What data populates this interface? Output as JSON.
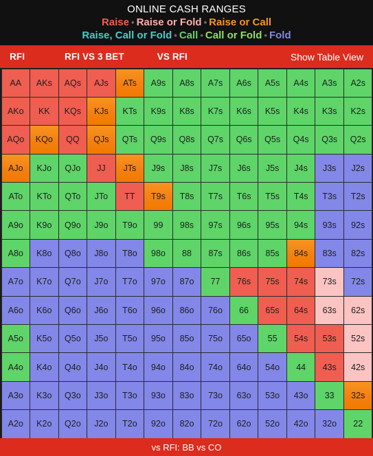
{
  "header": {
    "title": "ONLINE CASH RANGES",
    "legend_line1": [
      {
        "label": "Raise",
        "color": "#ef5e50"
      },
      {
        "label": "Raise or Fold",
        "color": "#fcb0ab"
      },
      {
        "label": "Raise or Call",
        "color": "#f79420"
      }
    ],
    "legend_line2": [
      {
        "label": "Raise, Call or Fold",
        "color": "#3fd0c9"
      },
      {
        "label": "Call",
        "color": "#5fd469"
      },
      {
        "label": "Call or Fold",
        "color": "#8ee05f"
      },
      {
        "label": "Fold",
        "color": "#8287e8"
      }
    ],
    "separator": "•"
  },
  "nav": {
    "items": [
      {
        "label": "RFI",
        "key": "rfi"
      },
      {
        "label": "RFI VS 3 BET",
        "key": "rfi-vs-3bet"
      },
      {
        "label": "VS RFI",
        "key": "vs-rfi"
      }
    ],
    "show_table_view": "Show Table View"
  },
  "footer": {
    "caption": "vs RFI: BB vs CO"
  },
  "chart_data": {
    "type": "heatmap",
    "title": "ONLINE CASH RANGES",
    "subtitle": "vs RFI: BB vs CO",
    "xlabel": "",
    "ylabel": "",
    "ranks": [
      "A",
      "K",
      "Q",
      "J",
      "T",
      "9",
      "8",
      "7",
      "6",
      "5",
      "4",
      "3",
      "2"
    ],
    "categories_legend": {
      "raise": "Raise",
      "raisefold": "Raise or Fold",
      "raisecall": "Raise or Call",
      "raisecallfold": "Raise, Call or Fold",
      "call": "Call",
      "callfold": "Call or Fold",
      "fold": "Fold"
    },
    "rows": [
      {
        "cells": [
          {
            "hand": "AA",
            "action": "raise"
          },
          {
            "hand": "AKs",
            "action": "raise"
          },
          {
            "hand": "AQs",
            "action": "raise"
          },
          {
            "hand": "AJs",
            "action": "raise"
          },
          {
            "hand": "ATs",
            "action": "raisecall"
          },
          {
            "hand": "A9s",
            "action": "call"
          },
          {
            "hand": "A8s",
            "action": "call"
          },
          {
            "hand": "A7s",
            "action": "call"
          },
          {
            "hand": "A6s",
            "action": "call"
          },
          {
            "hand": "A5s",
            "action": "call"
          },
          {
            "hand": "A4s",
            "action": "call"
          },
          {
            "hand": "A3s",
            "action": "call"
          },
          {
            "hand": "A2s",
            "action": "call"
          }
        ]
      },
      {
        "cells": [
          {
            "hand": "AKo",
            "action": "raise"
          },
          {
            "hand": "KK",
            "action": "raise"
          },
          {
            "hand": "KQs",
            "action": "raise"
          },
          {
            "hand": "KJs",
            "action": "raisecall"
          },
          {
            "hand": "KTs",
            "action": "call"
          },
          {
            "hand": "K9s",
            "action": "call"
          },
          {
            "hand": "K8s",
            "action": "call"
          },
          {
            "hand": "K7s",
            "action": "call"
          },
          {
            "hand": "K6s",
            "action": "call"
          },
          {
            "hand": "K5s",
            "action": "call"
          },
          {
            "hand": "K4s",
            "action": "call"
          },
          {
            "hand": "K3s",
            "action": "call"
          },
          {
            "hand": "K2s",
            "action": "call"
          }
        ]
      },
      {
        "cells": [
          {
            "hand": "AQo",
            "action": "raise"
          },
          {
            "hand": "KQo",
            "action": "raisecall"
          },
          {
            "hand": "QQ",
            "action": "raise"
          },
          {
            "hand": "QJs",
            "action": "raisecall"
          },
          {
            "hand": "QTs",
            "action": "call"
          },
          {
            "hand": "Q9s",
            "action": "call"
          },
          {
            "hand": "Q8s",
            "action": "call"
          },
          {
            "hand": "Q7s",
            "action": "call"
          },
          {
            "hand": "Q6s",
            "action": "call"
          },
          {
            "hand": "Q5s",
            "action": "call"
          },
          {
            "hand": "Q4s",
            "action": "call"
          },
          {
            "hand": "Q3s",
            "action": "call"
          },
          {
            "hand": "Q2s",
            "action": "call"
          }
        ]
      },
      {
        "cells": [
          {
            "hand": "AJo",
            "action": "raisecall"
          },
          {
            "hand": "KJo",
            "action": "call"
          },
          {
            "hand": "QJo",
            "action": "call"
          },
          {
            "hand": "JJ",
            "action": "raise"
          },
          {
            "hand": "JTs",
            "action": "raisecall"
          },
          {
            "hand": "J9s",
            "action": "call"
          },
          {
            "hand": "J8s",
            "action": "call"
          },
          {
            "hand": "J7s",
            "action": "call"
          },
          {
            "hand": "J6s",
            "action": "call"
          },
          {
            "hand": "J5s",
            "action": "call"
          },
          {
            "hand": "J4s",
            "action": "call"
          },
          {
            "hand": "J3s",
            "action": "fold"
          },
          {
            "hand": "J2s",
            "action": "fold"
          }
        ]
      },
      {
        "cells": [
          {
            "hand": "ATo",
            "action": "call"
          },
          {
            "hand": "KTo",
            "action": "call"
          },
          {
            "hand": "QTo",
            "action": "call"
          },
          {
            "hand": "JTo",
            "action": "call"
          },
          {
            "hand": "TT",
            "action": "raise"
          },
          {
            "hand": "T9s",
            "action": "raisecall"
          },
          {
            "hand": "T8s",
            "action": "call"
          },
          {
            "hand": "T7s",
            "action": "call"
          },
          {
            "hand": "T6s",
            "action": "call"
          },
          {
            "hand": "T5s",
            "action": "call"
          },
          {
            "hand": "T4s",
            "action": "call"
          },
          {
            "hand": "T3s",
            "action": "fold"
          },
          {
            "hand": "T2s",
            "action": "fold"
          }
        ]
      },
      {
        "cells": [
          {
            "hand": "A9o",
            "action": "call"
          },
          {
            "hand": "K9o",
            "action": "call"
          },
          {
            "hand": "Q9o",
            "action": "call"
          },
          {
            "hand": "J9o",
            "action": "call"
          },
          {
            "hand": "T9o",
            "action": "call"
          },
          {
            "hand": "99",
            "action": "call"
          },
          {
            "hand": "98s",
            "action": "call"
          },
          {
            "hand": "97s",
            "action": "call"
          },
          {
            "hand": "96s",
            "action": "call"
          },
          {
            "hand": "95s",
            "action": "call"
          },
          {
            "hand": "94s",
            "action": "call"
          },
          {
            "hand": "93s",
            "action": "fold"
          },
          {
            "hand": "92s",
            "action": "fold"
          }
        ]
      },
      {
        "cells": [
          {
            "hand": "A8o",
            "action": "call"
          },
          {
            "hand": "K8o",
            "action": "fold"
          },
          {
            "hand": "Q8o",
            "action": "fold"
          },
          {
            "hand": "J8o",
            "action": "fold"
          },
          {
            "hand": "T8o",
            "action": "fold"
          },
          {
            "hand": "98o",
            "action": "call"
          },
          {
            "hand": "88",
            "action": "call"
          },
          {
            "hand": "87s",
            "action": "call"
          },
          {
            "hand": "86s",
            "action": "call"
          },
          {
            "hand": "85s",
            "action": "call"
          },
          {
            "hand": "84s",
            "action": "raisecall"
          },
          {
            "hand": "83s",
            "action": "fold"
          },
          {
            "hand": "82s",
            "action": "fold"
          }
        ]
      },
      {
        "cells": [
          {
            "hand": "A7o",
            "action": "fold"
          },
          {
            "hand": "K7o",
            "action": "fold"
          },
          {
            "hand": "Q7o",
            "action": "fold"
          },
          {
            "hand": "J7o",
            "action": "fold"
          },
          {
            "hand": "T7o",
            "action": "fold"
          },
          {
            "hand": "97o",
            "action": "fold"
          },
          {
            "hand": "87o",
            "action": "fold"
          },
          {
            "hand": "77",
            "action": "call"
          },
          {
            "hand": "76s",
            "action": "raise"
          },
          {
            "hand": "75s",
            "action": "raise"
          },
          {
            "hand": "74s",
            "action": "raise"
          },
          {
            "hand": "73s",
            "action": "raisefold"
          },
          {
            "hand": "72s",
            "action": "fold"
          }
        ]
      },
      {
        "cells": [
          {
            "hand": "A6o",
            "action": "fold"
          },
          {
            "hand": "K6o",
            "action": "fold"
          },
          {
            "hand": "Q6o",
            "action": "fold"
          },
          {
            "hand": "J6o",
            "action": "fold"
          },
          {
            "hand": "T6o",
            "action": "fold"
          },
          {
            "hand": "96o",
            "action": "fold"
          },
          {
            "hand": "86o",
            "action": "fold"
          },
          {
            "hand": "76o",
            "action": "fold"
          },
          {
            "hand": "66",
            "action": "call"
          },
          {
            "hand": "65s",
            "action": "raise"
          },
          {
            "hand": "64s",
            "action": "raise"
          },
          {
            "hand": "63s",
            "action": "raisefold"
          },
          {
            "hand": "62s",
            "action": "raisefold"
          }
        ]
      },
      {
        "cells": [
          {
            "hand": "A5o",
            "action": "call"
          },
          {
            "hand": "K5o",
            "action": "fold"
          },
          {
            "hand": "Q5o",
            "action": "fold"
          },
          {
            "hand": "J5o",
            "action": "fold"
          },
          {
            "hand": "T5o",
            "action": "fold"
          },
          {
            "hand": "95o",
            "action": "fold"
          },
          {
            "hand": "85o",
            "action": "fold"
          },
          {
            "hand": "75o",
            "action": "fold"
          },
          {
            "hand": "65o",
            "action": "fold"
          },
          {
            "hand": "55",
            "action": "call"
          },
          {
            "hand": "54s",
            "action": "raise"
          },
          {
            "hand": "53s",
            "action": "raise"
          },
          {
            "hand": "52s",
            "action": "raisefold"
          }
        ]
      },
      {
        "cells": [
          {
            "hand": "A4o",
            "action": "call"
          },
          {
            "hand": "K4o",
            "action": "fold"
          },
          {
            "hand": "Q4o",
            "action": "fold"
          },
          {
            "hand": "J4o",
            "action": "fold"
          },
          {
            "hand": "T4o",
            "action": "fold"
          },
          {
            "hand": "94o",
            "action": "fold"
          },
          {
            "hand": "84o",
            "action": "fold"
          },
          {
            "hand": "74o",
            "action": "fold"
          },
          {
            "hand": "64o",
            "action": "fold"
          },
          {
            "hand": "54o",
            "action": "fold"
          },
          {
            "hand": "44",
            "action": "call"
          },
          {
            "hand": "43s",
            "action": "raise"
          },
          {
            "hand": "42s",
            "action": "raisefold"
          }
        ]
      },
      {
        "cells": [
          {
            "hand": "A3o",
            "action": "fold"
          },
          {
            "hand": "K3o",
            "action": "fold"
          },
          {
            "hand": "Q3o",
            "action": "fold"
          },
          {
            "hand": "J3o",
            "action": "fold"
          },
          {
            "hand": "T3o",
            "action": "fold"
          },
          {
            "hand": "93o",
            "action": "fold"
          },
          {
            "hand": "83o",
            "action": "fold"
          },
          {
            "hand": "73o",
            "action": "fold"
          },
          {
            "hand": "63o",
            "action": "fold"
          },
          {
            "hand": "53o",
            "action": "fold"
          },
          {
            "hand": "43o",
            "action": "fold"
          },
          {
            "hand": "33",
            "action": "call"
          },
          {
            "hand": "32s",
            "action": "raisecall"
          }
        ]
      },
      {
        "cells": [
          {
            "hand": "A2o",
            "action": "fold"
          },
          {
            "hand": "K2o",
            "action": "fold"
          },
          {
            "hand": "Q2o",
            "action": "fold"
          },
          {
            "hand": "J2o",
            "action": "fold"
          },
          {
            "hand": "T2o",
            "action": "fold"
          },
          {
            "hand": "92o",
            "action": "fold"
          },
          {
            "hand": "82o",
            "action": "fold"
          },
          {
            "hand": "72o",
            "action": "fold"
          },
          {
            "hand": "62o",
            "action": "fold"
          },
          {
            "hand": "52o",
            "action": "fold"
          },
          {
            "hand": "42o",
            "action": "fold"
          },
          {
            "hand": "32o",
            "action": "fold"
          },
          {
            "hand": "22",
            "action": "call"
          }
        ]
      }
    ]
  }
}
